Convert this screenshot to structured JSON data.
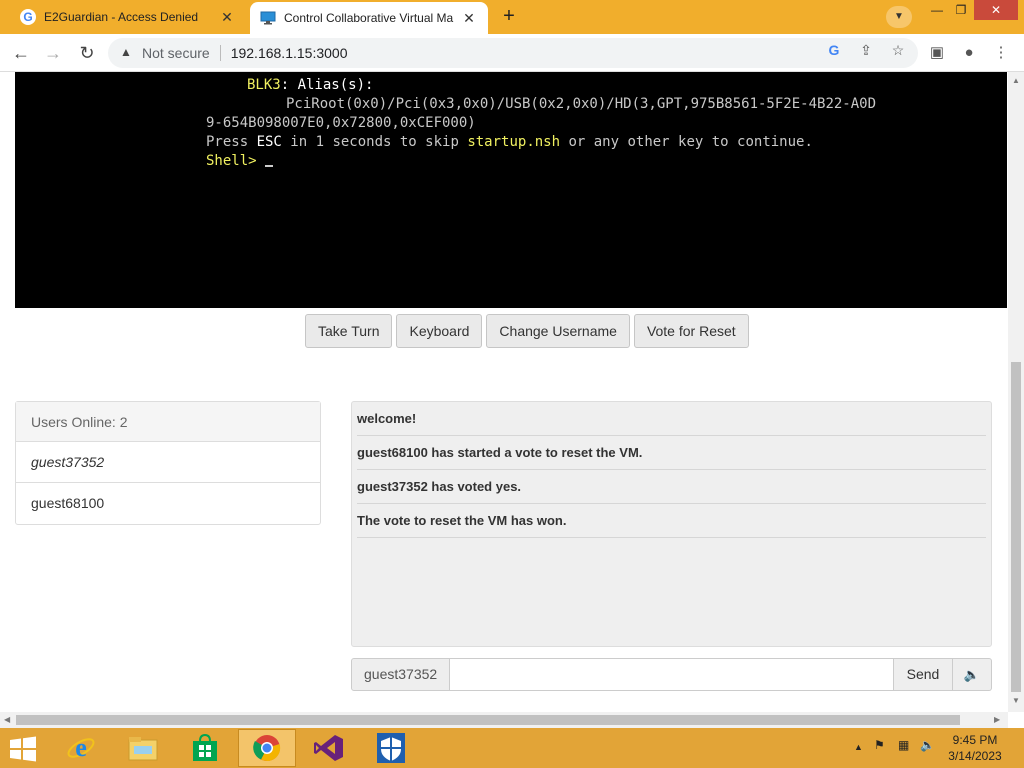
{
  "browser": {
    "tabs": [
      {
        "title": "E2Guardian - Access Denied",
        "icon": "google-g-icon"
      },
      {
        "title": "Control Collaborative Virtual Ma",
        "icon": "monitor-icon"
      }
    ],
    "address": {
      "security_label": "Not secure",
      "url": "192.168.1.15:3000"
    }
  },
  "vm_console": {
    "line1_device": "BLK3",
    "line1_rest": ": Alias(s):",
    "line2": "PciRoot(0x0)/Pci(0x3,0x0)/USB(0x2,0x0)/HD(3,GPT,975B8561-5F2E-4B22-A0D",
    "line3": "9-654B098007E0,0x72800,0xCEF000)",
    "line4_a": "Press ",
    "line4_esc": "ESC",
    "line4_b": " in 1 seconds to skip ",
    "line4_file": "startup.nsh",
    "line4_c": " or any other key to continue.",
    "prompt": "Shell> "
  },
  "controls": {
    "take_turn": "Take Turn",
    "keyboard": "Keyboard",
    "change_username": "Change Username",
    "vote_reset": "Vote for Reset"
  },
  "users": {
    "header": "Users Online: 2",
    "list": [
      "guest37352",
      "guest68100"
    ]
  },
  "chat": {
    "messages": [
      "welcome!",
      "guest68100 has started a vote to reset the VM.",
      "guest37352 has voted yes.",
      "The vote to reset the VM has won."
    ],
    "username": "guest37352",
    "input_value": "",
    "send_label": "Send"
  },
  "taskbar": {
    "apps": [
      "internet-explorer-icon",
      "file-explorer-icon",
      "store-icon",
      "chrome-icon",
      "visual-studio-icon",
      "shield-app-icon"
    ],
    "active_app": "chrome-icon",
    "time": "9:45 PM",
    "date": "3/14/2023"
  },
  "colors": {
    "tabstrip": "#f1ae2c",
    "taskbar": "#e2a437",
    "console_bg": "#000000",
    "console_highlight": "#f0f060"
  }
}
